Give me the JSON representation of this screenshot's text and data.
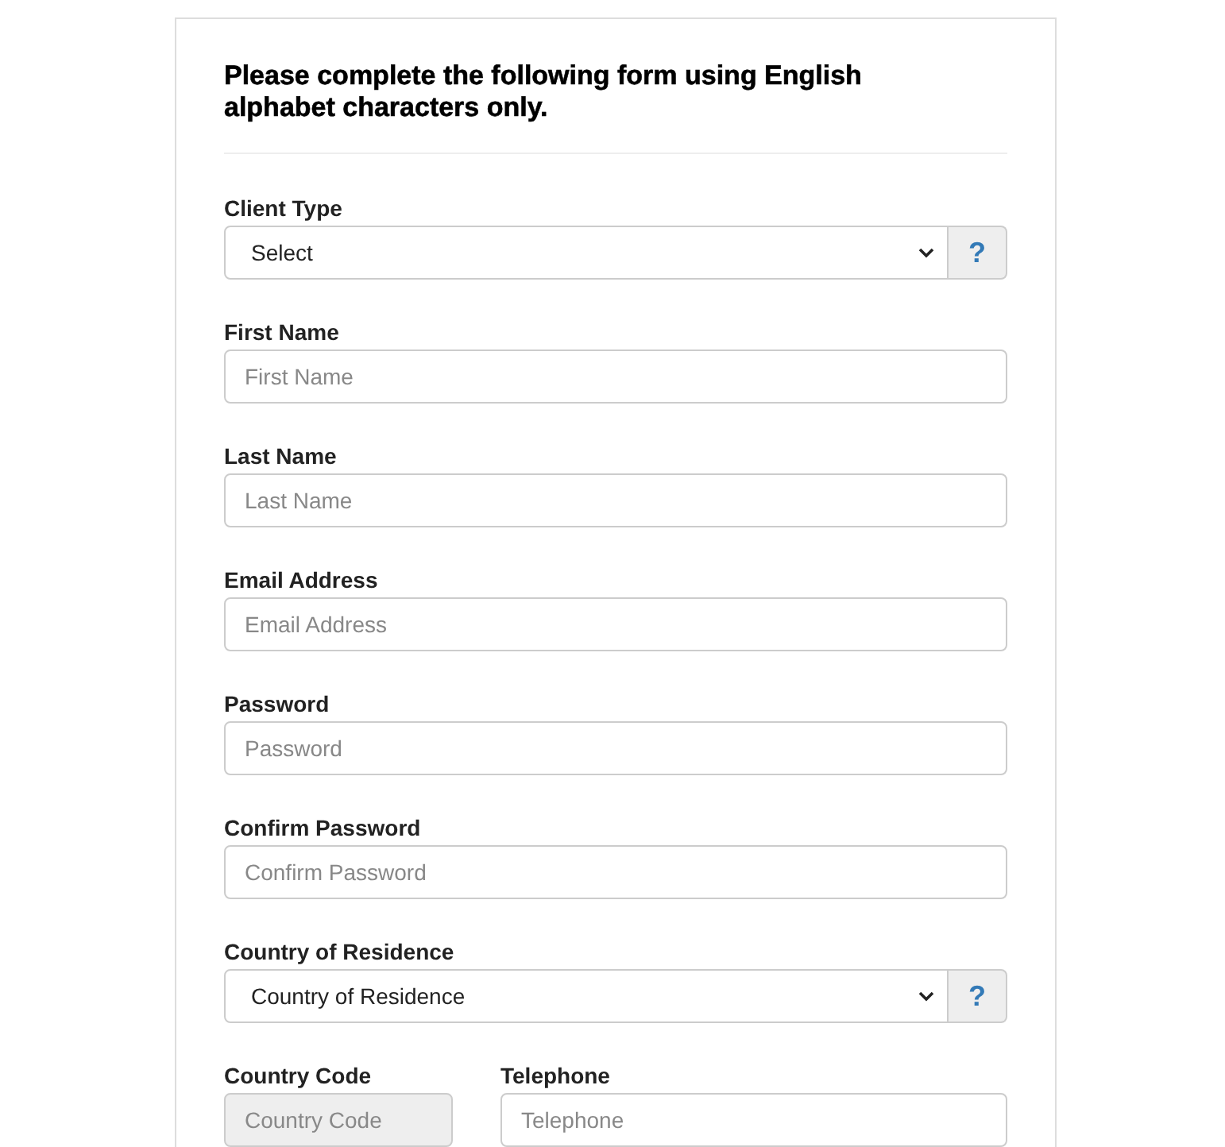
{
  "heading": "Please complete the following form using English alphabet characters only.",
  "fields": [
    {
      "kind": "select",
      "label": "Client Type",
      "value": "Select",
      "help": "?"
    },
    {
      "kind": "input",
      "label": "First Name",
      "placeholder": "First Name"
    },
    {
      "kind": "input",
      "label": "Last Name",
      "placeholder": "Last Name"
    },
    {
      "kind": "input",
      "label": "Email Address",
      "placeholder": "Email Address"
    },
    {
      "kind": "input",
      "label": "Password",
      "placeholder": "Password"
    },
    {
      "kind": "input",
      "label": "Confirm Password",
      "placeholder": "Confirm Password"
    },
    {
      "kind": "select",
      "label": "Country of Residence",
      "value": "Country of Residence",
      "help": "?"
    }
  ],
  "phone_row": [
    {
      "label": "Country Code",
      "placeholder": "Country Code",
      "disabled": true
    },
    {
      "label": "Telephone",
      "placeholder": "Telephone",
      "disabled": false
    }
  ]
}
